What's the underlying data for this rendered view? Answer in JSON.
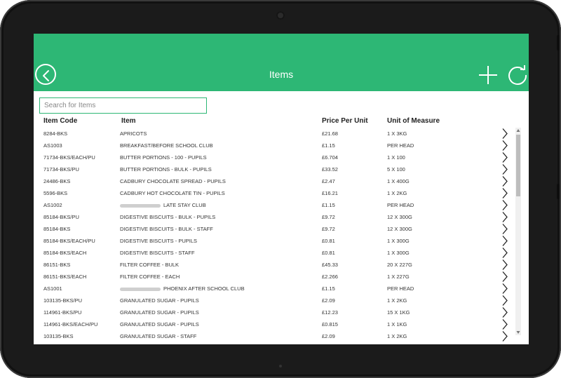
{
  "header": {
    "title": "Items"
  },
  "search": {
    "placeholder": "Search for Items",
    "value": ""
  },
  "columns": {
    "code": "Item Code",
    "item": "Item",
    "price": "Price Per Unit",
    "uom": "Unit of Measure"
  },
  "rows": [
    {
      "code": "8284-BKS",
      "item": "APRICOTS",
      "redacted": false,
      "price": "£21.68",
      "uom": "1 X 3KG"
    },
    {
      "code": "AS1003",
      "item": "BREAKFAST/BEFORE SCHOOL CLUB",
      "redacted": false,
      "price": "£1.15",
      "uom": "PER HEAD"
    },
    {
      "code": "71734-BKS/EACH/PU",
      "item": "BUTTER PORTIONS - 100 - PUPILS",
      "redacted": false,
      "price": "£6.704",
      "uom": "1 X 100"
    },
    {
      "code": "71734-BKS/PU",
      "item": "BUTTER PORTIONS - BULK - PUPILS",
      "redacted": false,
      "price": "£33.52",
      "uom": "5 X 100"
    },
    {
      "code": "24486-BKS",
      "item": "CADBURY CHOCOLATE SPREAD - PUPILS",
      "redacted": false,
      "price": "£2.47",
      "uom": "1 X 400G"
    },
    {
      "code": "5596-BKS",
      "item": "CADBURY HOT CHOCOLATE TIN - PUPILS",
      "redacted": false,
      "price": "£16.21",
      "uom": "1 X 2KG"
    },
    {
      "code": "AS1002",
      "item": "LATE STAY CLUB",
      "redacted": true,
      "price": "£1.15",
      "uom": "PER HEAD"
    },
    {
      "code": "85184-BKS/PU",
      "item": "DIGESTIVE BISCUITS - BULK - PUPILS",
      "redacted": false,
      "price": "£9.72",
      "uom": "12 X 300G"
    },
    {
      "code": "85184-BKS",
      "item": "DIGESTIVE BISCUITS - BULK - STAFF",
      "redacted": false,
      "price": "£9.72",
      "uom": "12 X 300G"
    },
    {
      "code": "85184-BKS/EACH/PU",
      "item": "DIGESTIVE BISCUITS - PUPILS",
      "redacted": false,
      "price": "£0.81",
      "uom": "1 X 300G"
    },
    {
      "code": "85184-BKS/EACH",
      "item": "DIGESTIVE BISCUITS - STAFF",
      "redacted": false,
      "price": "£0.81",
      "uom": "1 X 300G"
    },
    {
      "code": "86151-BKS",
      "item": "FILTER COFFEE - BULK",
      "redacted": false,
      "price": "£45.33",
      "uom": "20 X 227G"
    },
    {
      "code": "86151-BKS/EACH",
      "item": "FILTER COFFEE - EACH",
      "redacted": false,
      "price": "£2.266",
      "uom": "1 X 227G"
    },
    {
      "code": "AS1001",
      "item": "PHOENIX AFTER SCHOOL CLUB",
      "redacted": true,
      "price": "£1.15",
      "uom": "PER HEAD"
    },
    {
      "code": "103135-BKS/PU",
      "item": "GRANULATED SUGAR - PUPILS",
      "redacted": false,
      "price": "£2.09",
      "uom": "1 X 2KG"
    },
    {
      "code": "114961-BKS/PU",
      "item": "GRANULATED SUGAR - PUPILS",
      "redacted": false,
      "price": "£12.23",
      "uom": "15 X 1KG"
    },
    {
      "code": "114961-BKS/EACH/PU",
      "item": "GRANULATED SUGAR - PUPILS",
      "redacted": false,
      "price": "£0.815",
      "uom": "1 X 1KG"
    },
    {
      "code": "103135-BKS",
      "item": "GRANULATED SUGAR - STAFF",
      "redacted": false,
      "price": "£2.09",
      "uom": "1 X 2KG"
    }
  ],
  "icons": {
    "back": "chevron-left-circle-icon",
    "add": "plus-icon",
    "refresh": "refresh-icon",
    "row": "chevron-right-icon"
  },
  "colors": {
    "accent": "#2db775",
    "device": "#1b1b1b"
  }
}
